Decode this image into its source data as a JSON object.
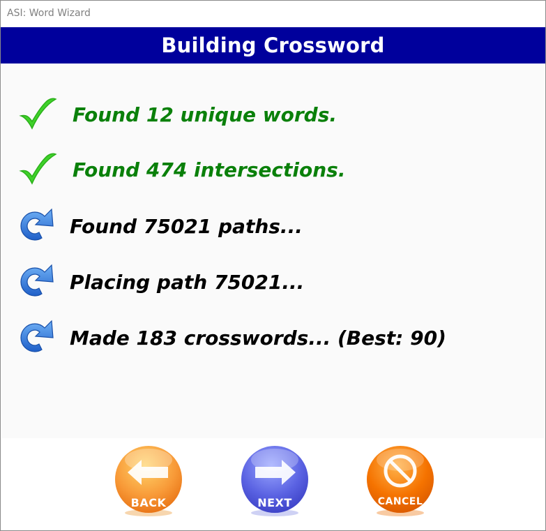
{
  "window": {
    "title": "ASI: Word Wizard"
  },
  "header": {
    "title": "Building Crossword"
  },
  "steps": [
    {
      "text": "Found 12 unique words.",
      "status": "done",
      "icon": "checkmark-icon"
    },
    {
      "text": "Found 474 intersections.",
      "status": "done",
      "icon": "checkmark-icon"
    },
    {
      "text": "Found 75021 paths...",
      "status": "in-progress",
      "icon": "refresh-icon"
    },
    {
      "text": "Placing path 75021...",
      "status": "in-progress",
      "icon": "refresh-icon"
    },
    {
      "text": "Made 183 crosswords... (Best: 90)",
      "status": "in-progress",
      "icon": "refresh-icon"
    }
  ],
  "buttons": {
    "back": {
      "label": "BACK",
      "icon": "arrow-left-icon",
      "color": "#f79a3a"
    },
    "next": {
      "label": "NEXT",
      "icon": "arrow-right-icon",
      "color": "#5a60e0"
    },
    "cancel": {
      "label": "CANCEL",
      "icon": "cancel-icon",
      "color": "#f57300"
    }
  },
  "colors": {
    "header_bg": "#00009c",
    "done_text": "#0a800a",
    "pending_text": "#000000",
    "check": "#3fd12a",
    "refresh": "#2f7fe0"
  }
}
